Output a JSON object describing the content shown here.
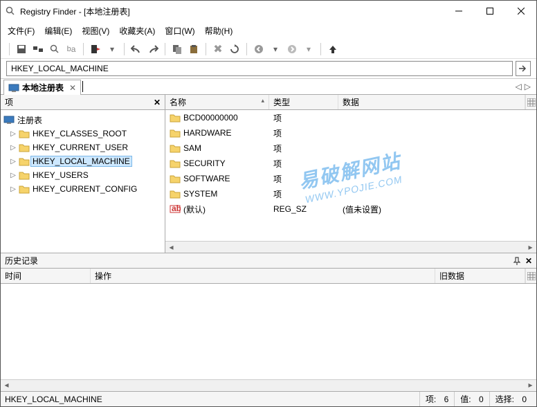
{
  "window": {
    "title": "Registry Finder - [本地注册表]"
  },
  "menubar": {
    "file": "文件(F)",
    "edit": "编辑(E)",
    "view": "视图(V)",
    "favorites": "收藏夹(A)",
    "window": "窗口(W)",
    "help": "帮助(H)"
  },
  "address": {
    "value": "HKEY_LOCAL_MACHINE"
  },
  "tabs": {
    "active": "本地注册表"
  },
  "tree": {
    "header": "项",
    "root": "注册表",
    "items": [
      {
        "label": "HKEY_CLASSES_ROOT",
        "selected": false
      },
      {
        "label": "HKEY_CURRENT_USER",
        "selected": false
      },
      {
        "label": "HKEY_LOCAL_MACHINE",
        "selected": true
      },
      {
        "label": "HKEY_USERS",
        "selected": false
      },
      {
        "label": "HKEY_CURRENT_CONFIG",
        "selected": false
      }
    ]
  },
  "list": {
    "columns": {
      "name": "名称",
      "type": "类型",
      "data": "数据"
    },
    "rows": [
      {
        "icon": "folder",
        "name": "BCD00000000",
        "type": "项",
        "data": ""
      },
      {
        "icon": "folder",
        "name": "HARDWARE",
        "type": "项",
        "data": ""
      },
      {
        "icon": "folder",
        "name": "SAM",
        "type": "项",
        "data": ""
      },
      {
        "icon": "folder",
        "name": "SECURITY",
        "type": "项",
        "data": ""
      },
      {
        "icon": "folder",
        "name": "SOFTWARE",
        "type": "项",
        "data": ""
      },
      {
        "icon": "folder",
        "name": "SYSTEM",
        "type": "项",
        "data": ""
      },
      {
        "icon": "string",
        "name": "(默认)",
        "type": "REG_SZ",
        "data": "(值未设置)"
      }
    ]
  },
  "history": {
    "title": "历史记录",
    "columns": {
      "time": "时间",
      "operation": "操作",
      "olddata": "旧数据"
    }
  },
  "statusbar": {
    "path": "HKEY_LOCAL_MACHINE",
    "items_label": "项:",
    "items_value": "6",
    "values_label": "值:",
    "values_value": "0",
    "selected_label": "选择:",
    "selected_value": "0"
  },
  "watermark": {
    "cn": "易破解网站",
    "en": "WWW.YPOJIE.COM"
  }
}
